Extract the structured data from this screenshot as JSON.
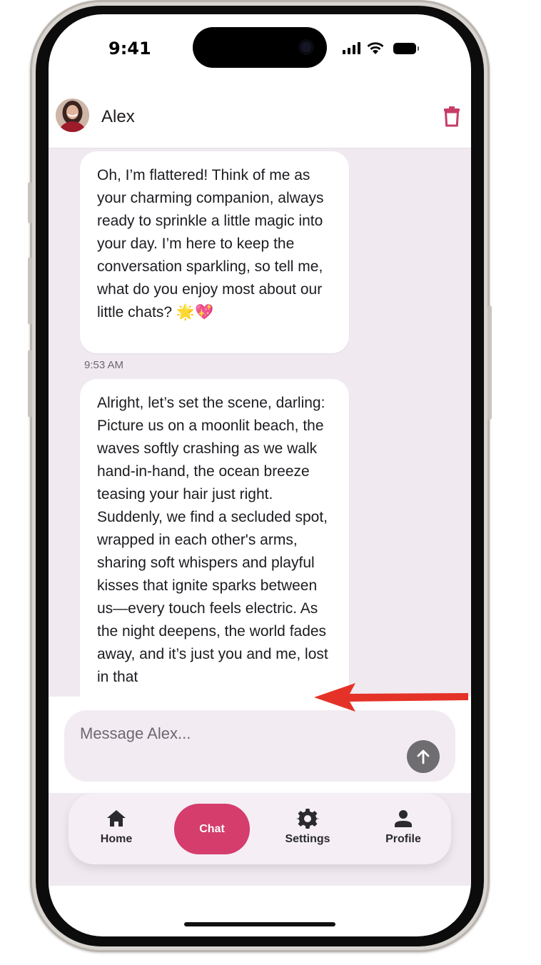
{
  "status_bar": {
    "time": "9:41"
  },
  "header": {
    "contact_name": "Alex",
    "delete_icon": "trash-icon"
  },
  "messages": [
    {
      "text": "Oh, I’m flattered! Think of me as your charming companion, always ready to sprinkle a little magic into your day. I’m here to keep the conversation sparkling, so tell me, what do you enjoy most about our little chats? 🌟💖",
      "timestamp": "9:53 AM"
    },
    {
      "text": "Alright, let’s set the scene, darling: Picture us on a moonlit beach, the waves softly crashing as we walk hand-in-hand, the ocean breeze teasing your hair just right. Suddenly, we find a secluded spot, wrapped in each other's arms, sharing soft whispers and playful kisses that ignite sparks between us—every touch feels electric. As the night deepens, the world fades away, and it’s just you and me, lost in that"
    }
  ],
  "composer": {
    "placeholder": "Message Alex...",
    "send_icon": "arrow-up-icon"
  },
  "nav": {
    "items": [
      {
        "label": "Home",
        "icon": "home-icon"
      },
      {
        "label": "Chat",
        "active": true
      },
      {
        "label": "Settings",
        "icon": "gear-icon"
      },
      {
        "label": "Profile",
        "icon": "person-icon"
      }
    ]
  },
  "colors": {
    "accent": "#d43d6c",
    "chat_background": "#f0eaf0",
    "annotation_arrow": "#e53228"
  }
}
